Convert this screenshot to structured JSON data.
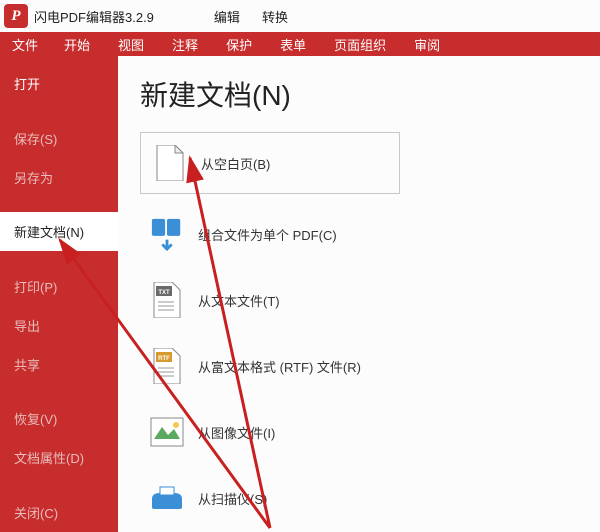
{
  "app": {
    "logo_letter": "P",
    "title": "闪电PDF编辑器3.2.9",
    "menu": [
      "编辑",
      "转换"
    ]
  },
  "ribbon": {
    "file": "文件",
    "items": [
      "开始",
      "视图",
      "注释",
      "保护",
      "表单",
      "页面组织",
      "审阅"
    ]
  },
  "sidebar": {
    "items": [
      {
        "label": "打开",
        "bright": true,
        "active": false
      },
      {
        "label": "保存(S)",
        "bright": false,
        "active": false
      },
      {
        "label": "另存为",
        "bright": false,
        "active": false
      },
      {
        "label": "新建文档(N)",
        "bright": false,
        "active": true
      },
      {
        "label": "打印(P)",
        "bright": false,
        "active": false
      },
      {
        "label": "导出",
        "bright": false,
        "active": false
      },
      {
        "label": "共享",
        "bright": false,
        "active": false
      },
      {
        "label": "恢复(V)",
        "bright": false,
        "active": false
      },
      {
        "label": "文档属性(D)",
        "bright": false,
        "active": false
      },
      {
        "label": "关闭(C)",
        "bright": false,
        "active": false
      }
    ]
  },
  "page": {
    "title": "新建文档(N)",
    "options": {
      "blank": "从空白页(B)",
      "combine": "组合文件为单个 PDF(C)",
      "text": "从文本文件(T)",
      "rtf": "从富文本格式 (RTF) 文件(R)",
      "image": "从图像文件(I)",
      "scanner": "从扫描仪(S)"
    }
  }
}
